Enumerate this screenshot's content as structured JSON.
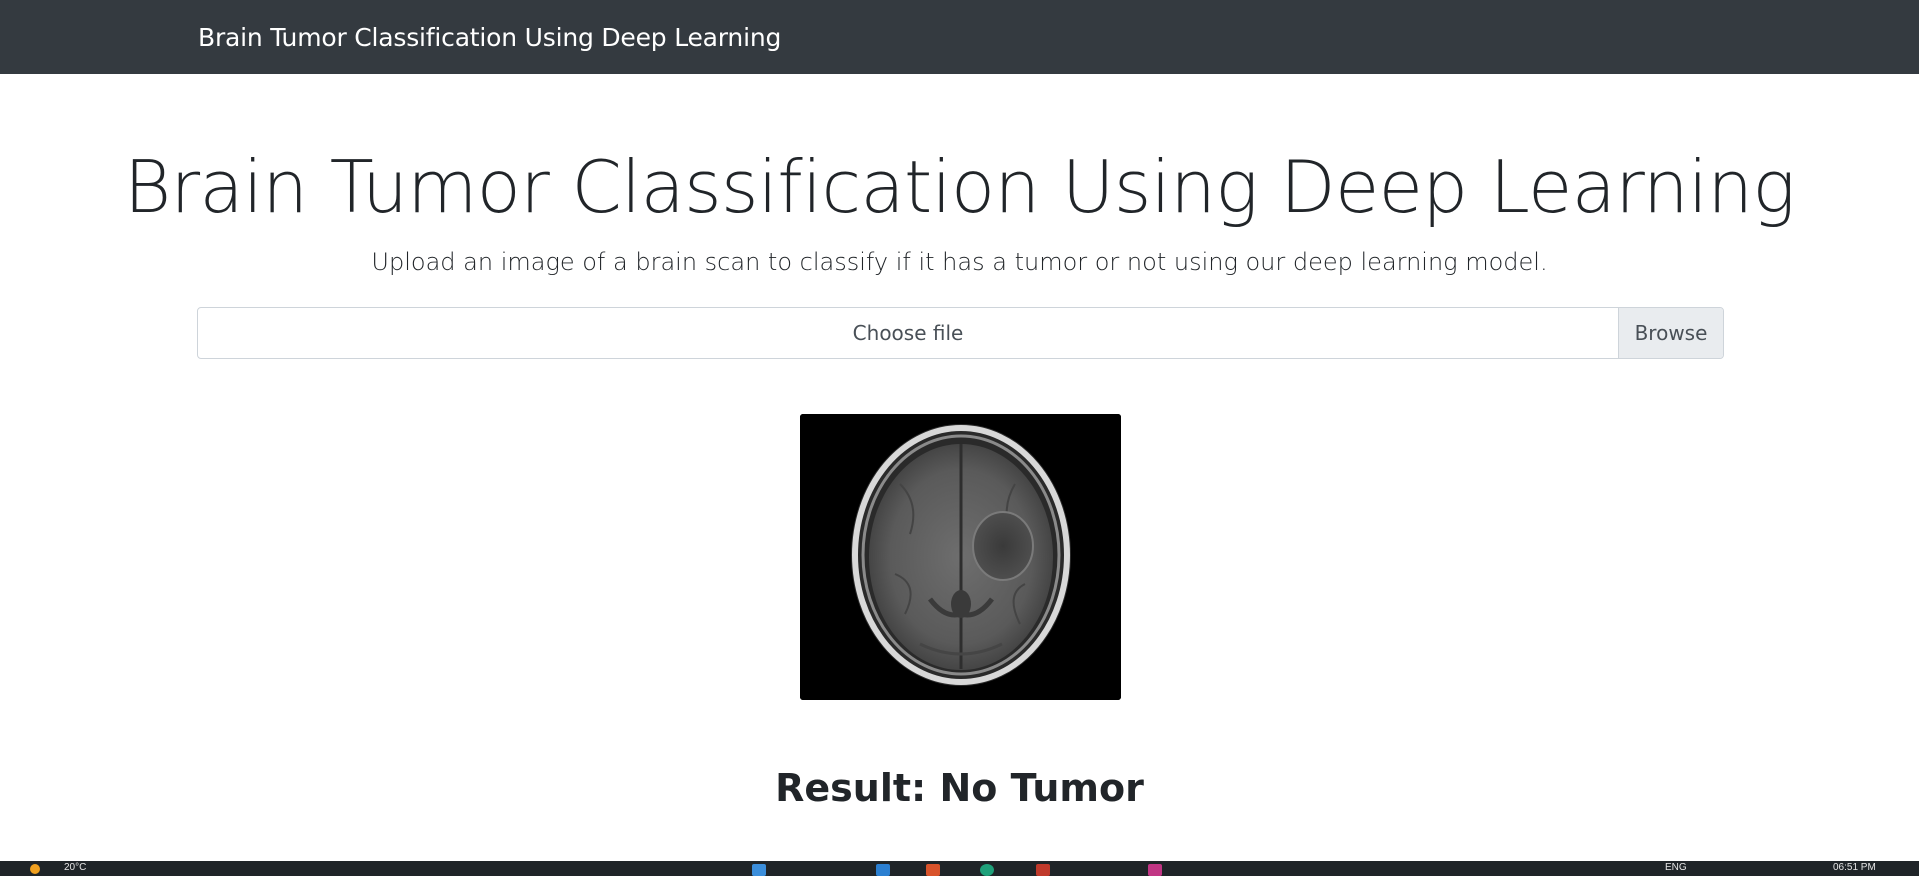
{
  "navbar": {
    "brand": "Brain Tumor Classification Using Deep Learning"
  },
  "main": {
    "title": "Brain Tumor Classification Using Deep Learning",
    "lead": "Upload an image of a brain scan to classify if it has a tumor or not using our deep learning model.",
    "file_input": {
      "label": "Choose file",
      "browse_label": "Browse"
    },
    "result": "Result: No Tumor"
  },
  "taskbar": {
    "weather": "20°C",
    "language": "ENG",
    "clock": "06:51 PM"
  },
  "colors": {
    "navbar_bg": "#343a40",
    "page_bg": "#ffffff",
    "text": "#212529",
    "input_border": "#ced4da",
    "browse_bg": "#e9ecef",
    "taskbar_bg": "#1f2428"
  },
  "icons": {
    "weather": "sun-icon",
    "taskbar_apps": [
      "file-explorer-icon",
      "browser-icon",
      "app-icon",
      "chrome-icon",
      "media-icon",
      "instagram-icon"
    ]
  }
}
